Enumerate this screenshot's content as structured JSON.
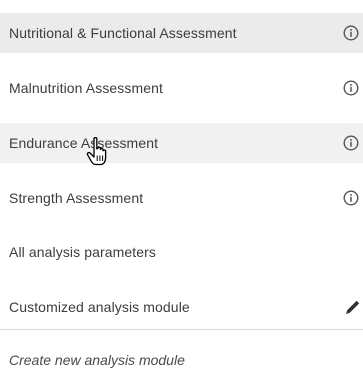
{
  "menu": {
    "items": [
      {
        "label": "Nutritional & Functional Assessment",
        "icon": "info-icon"
      },
      {
        "label": "Malnutrition Assessment",
        "icon": "info-icon"
      },
      {
        "label": "Endurance Assessment",
        "icon": "info-icon"
      },
      {
        "label": "Strength Assessment",
        "icon": "info-icon"
      },
      {
        "label": "All analysis parameters",
        "icon": ""
      },
      {
        "label": "Customized analysis module",
        "icon": "pencil-icon"
      }
    ],
    "create_label": "Create new analysis module",
    "highlighted_item": "Nutritional & Functional Assessment",
    "hovered_item": "Endurance Assessment"
  },
  "colors": {
    "highlight_bg": "#ebebeb",
    "text": "#3c3c3c",
    "icon": "#555555"
  }
}
